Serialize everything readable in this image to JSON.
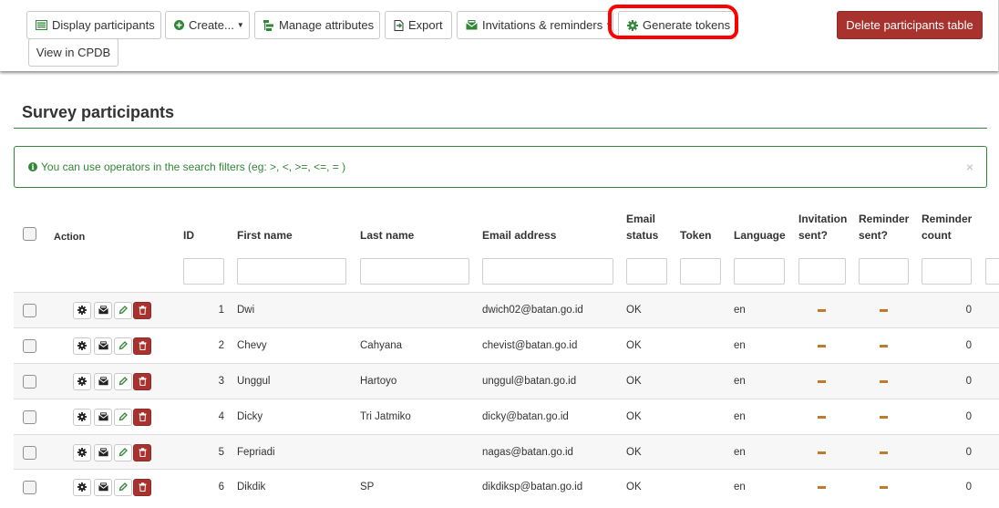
{
  "toolbar": {
    "display_participants": "Display participants",
    "create": "Create...",
    "manage_attributes": "Manage attributes",
    "export": "Export",
    "invitations": "Invitations & reminders",
    "generate_tokens": "Generate tokens",
    "delete_table": "Delete participants table",
    "view_cpdb": "View in CPDB"
  },
  "page": {
    "title": "Survey participants"
  },
  "alert": {
    "text": "You can use operators in the search filters (eg: >, <, >=, <=, = )",
    "close": "×"
  },
  "table": {
    "headers": {
      "action": "Action",
      "id": "ID",
      "first_name": "First name",
      "last_name": "Last name",
      "email": "Email address",
      "email_status_1": "Email",
      "email_status_2": "status",
      "token": "Token",
      "language": "Language",
      "inv_sent_1": "Invitation",
      "inv_sent_2": "sent?",
      "rem_sent_1": "Reminder",
      "rem_sent_2": "sent?",
      "rem_count_1": "Reminder",
      "rem_count_2": "count"
    },
    "rows": [
      {
        "id": "1",
        "first_name": "Dwi",
        "last_name": "",
        "email": "dwich02@batan.go.id",
        "email_status": "OK",
        "token": "",
        "language": "en",
        "reminder_count": "0"
      },
      {
        "id": "2",
        "first_name": "Chevy",
        "last_name": "Cahyana",
        "email": "chevist@batan.go.id",
        "email_status": "OK",
        "token": "",
        "language": "en",
        "reminder_count": "0"
      },
      {
        "id": "3",
        "first_name": "Unggul",
        "last_name": "Hartoyo",
        "email": "unggul@batan.go.id",
        "email_status": "OK",
        "token": "",
        "language": "en",
        "reminder_count": "0"
      },
      {
        "id": "4",
        "first_name": "Dicky",
        "last_name": "Tri Jatmiko",
        "email": "dicky@batan.go.id",
        "email_status": "OK",
        "token": "",
        "language": "en",
        "reminder_count": "0"
      },
      {
        "id": "5",
        "first_name": "Fepriadi",
        "last_name": "",
        "email": "nagas@batan.go.id",
        "email_status": "OK",
        "token": "",
        "language": "en",
        "reminder_count": "0"
      },
      {
        "id": "6",
        "first_name": "Dikdik",
        "last_name": "SP",
        "email": "dikdiksp@batan.go.id",
        "email_status": "OK",
        "token": "",
        "language": "en",
        "reminder_count": "0"
      }
    ]
  },
  "colors": {
    "accent": "#328637",
    "danger": "#a8322d",
    "highlight": "#ff0000",
    "dash": "#c07a2c"
  }
}
